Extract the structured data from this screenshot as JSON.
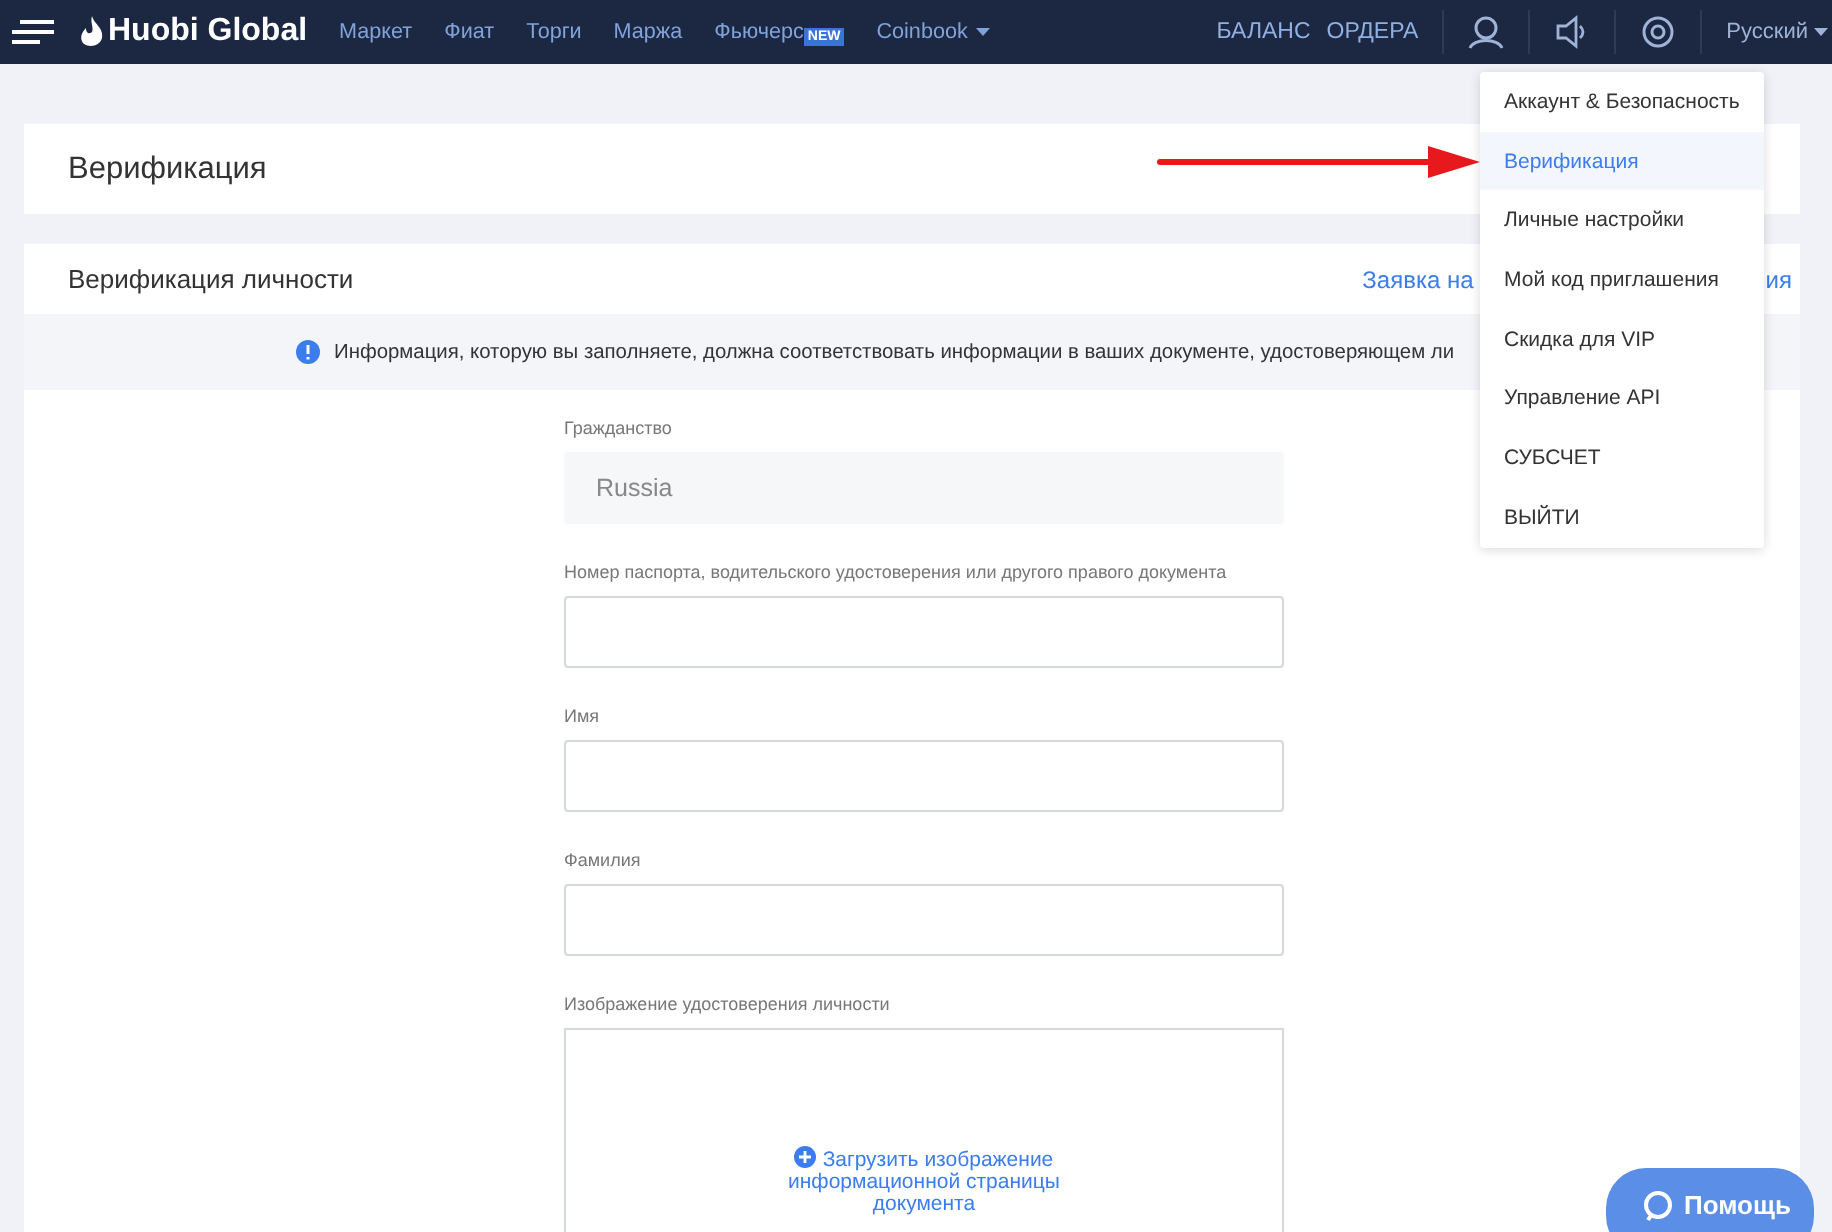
{
  "navbar": {
    "logo": "Huobi Global",
    "links": [
      {
        "label": "Маркет"
      },
      {
        "label": "Фиат"
      },
      {
        "label": "Торги"
      },
      {
        "label": "Маржа"
      },
      {
        "label": "Фьючерс",
        "badge": "NEW"
      },
      {
        "label": "Coinbook",
        "dropdown": true
      }
    ],
    "right_links": [
      "БАЛАНС",
      "ОРДЕРА"
    ],
    "language": "Русский"
  },
  "page_title": "Верификация",
  "section": {
    "title": "Верификация личности",
    "link_start": "Заявка на",
    "link_end": "ия"
  },
  "info_banner": "Информация, которую вы заполняете, должна соответствовать информации в ваших документе, удостоверяющем ли",
  "form": {
    "fields": [
      {
        "label": "Гражданство",
        "value": "Russia",
        "disabled": true
      },
      {
        "label": "Номер паспорта, водительского удостоверения или другого правого документа",
        "disabled": false
      },
      {
        "label": "Имя",
        "disabled": false
      },
      {
        "label": "Фамилия",
        "disabled": false
      }
    ],
    "upload": {
      "label": "Изображение удостоверения личности",
      "action": "Загрузить изображение информационной страницы документа"
    }
  },
  "account_menu": {
    "items": [
      {
        "label": "Аккаунт & Безопасность",
        "selected": false
      },
      {
        "label": "Верификация",
        "selected": true
      },
      {
        "label": "Личные настройки",
        "selected": false
      },
      {
        "label": "Мой код приглашения",
        "selected": false
      },
      {
        "label": "Скидка для VIP",
        "selected": false
      },
      {
        "label": "Управление API",
        "selected": false
      },
      {
        "label": "СУБСЧЕТ",
        "selected": false
      },
      {
        "label": "ВЫЙТИ",
        "selected": false
      }
    ]
  },
  "help_button": "Помощь"
}
